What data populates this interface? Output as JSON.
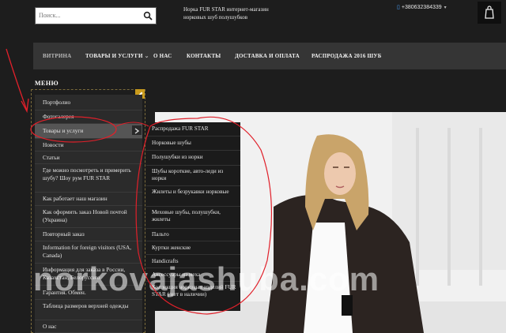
{
  "header": {
    "search_placeholder": "Поиск...",
    "tagline": "Норка FUR STAR интернет-магазин норковых шуб полушубков",
    "phone": "+380632384339"
  },
  "nav": {
    "items": [
      {
        "label": "ВИТРИНА"
      },
      {
        "label": "ТОВАРЫ И УСЛУГИ"
      },
      {
        "label": "О НАС"
      },
      {
        "label": "КОНТАКТЫ"
      },
      {
        "label": "ДОСТАВКА И ОПЛАТА"
      },
      {
        "label": "РАСПРОДАЖА 2016 ШУБ"
      }
    ]
  },
  "menu": {
    "title": "МЕНЮ",
    "items": [
      {
        "label": "Портфолио"
      },
      {
        "label": "Фотогалерея"
      },
      {
        "label": "Товары и услуги"
      },
      {
        "label": "Новости"
      },
      {
        "label": "Статьи"
      },
      {
        "label": "Где можно посмотреть и примерить шубу? Шоу рум FUR STAR"
      },
      {
        "label": "Как работает наш магазин"
      },
      {
        "label": "Как оформить заказ Новой почтой (Украина)"
      },
      {
        "label": "Повторный заказ"
      },
      {
        "label": "Information for foreign visitors (USA, Canada)"
      },
      {
        "label": "Информация для заказа в России, Казахстан, Белоруссию"
      },
      {
        "label": "Гарантия. Обмен."
      },
      {
        "label": "Таблица размеров верхней одежды"
      },
      {
        "label": "О нас"
      }
    ]
  },
  "submenu": {
    "items": [
      {
        "label": "Распродажа FUR STAR"
      },
      {
        "label": "Норковые шубы"
      },
      {
        "label": "Полушубки из норки"
      },
      {
        "label": "Шубы короткие, авто-леди из норки"
      },
      {
        "label": "Жилеты и безрукавки норковые"
      },
      {
        "label": "Меховые шубы, полушубки, жилеты"
      },
      {
        "label": "Пальто"
      },
      {
        "label": "Куртки женские"
      },
      {
        "label": "Handicrafts"
      },
      {
        "label": "Аксессуары из меха"
      },
      {
        "label": "Коллекция норковых изделий FUR STAR ( нет в наличии)"
      }
    ]
  },
  "watermark": "norkovajashuba.com",
  "colors": {
    "background": "#1d1d1d",
    "nav_bar": "#353535",
    "menu_bg": "#2b2b2b",
    "menu_highlight": "#555555",
    "submenu_bg": "#1b1b1b",
    "edit_accent": "#c99a1c",
    "annotation_red": "#e0202a"
  },
  "icons": {
    "search": "search-icon",
    "cart": "cart-icon",
    "phone": "phone-icon",
    "edit": "pencil-icon",
    "submenu_arrow": "chevron-right-icon",
    "nav_dropdown": "chevron-down-icon"
  }
}
